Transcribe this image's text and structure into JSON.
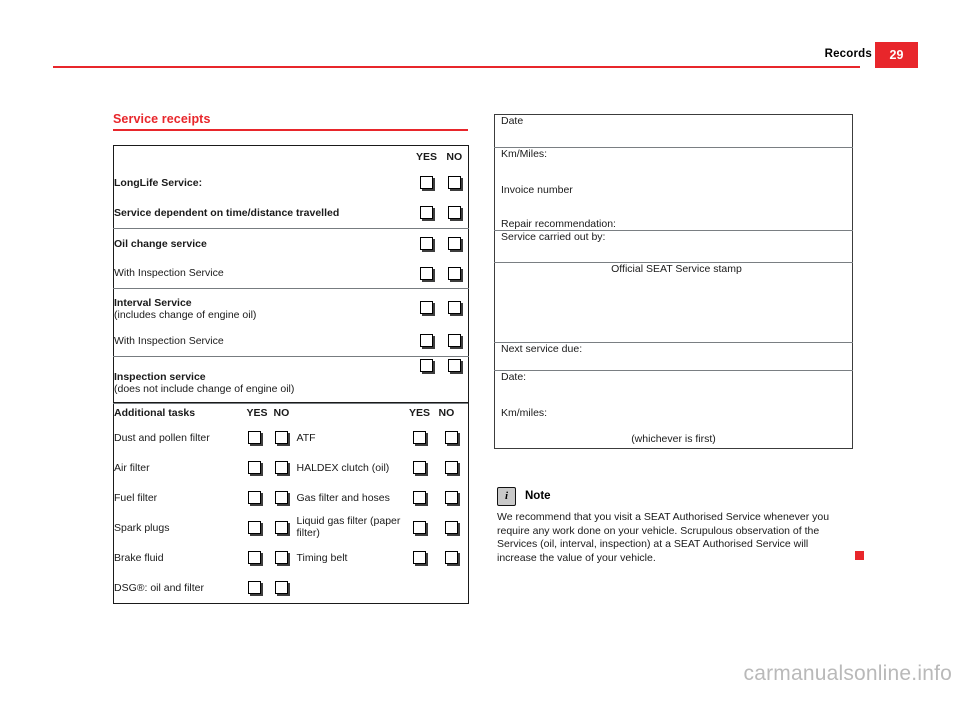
{
  "header": {
    "title": "Records",
    "page_number": "29"
  },
  "section": {
    "title": "Service receipts"
  },
  "service_table": {
    "yes_label": "YES",
    "no_label": "NO",
    "rows": [
      {
        "label": "LongLife Service:",
        "bold": true,
        "sub": ""
      },
      {
        "label": "Service dependent on time/distance travelled",
        "bold": true,
        "sub": ""
      },
      {
        "label": "Oil change service",
        "bold": true,
        "sub": ""
      },
      {
        "label": "With Inspection Service",
        "bold": false,
        "sub": ""
      },
      {
        "label": "Interval Service",
        "bold": true,
        "sub": "(includes change of engine oil)"
      },
      {
        "label": "With Inspection Service",
        "bold": false,
        "sub": ""
      },
      {
        "label": "Inspection service",
        "bold": true,
        "sub": "(does not include change of engine oil)"
      }
    ]
  },
  "additional_tasks": {
    "heading": "Additional tasks",
    "yes_label_left": "YES",
    "no_label_left": "NO",
    "yes_label_right": "YES",
    "no_label_right": "NO",
    "left_items": [
      "Dust and pollen filter",
      "Air filter",
      "Fuel filter",
      "Spark plugs",
      "Brake fluid",
      "DSG®: oil and filter"
    ],
    "right_items": [
      "ATF",
      "HALDEX clutch (oil)",
      "Gas filter and hoses",
      "Liquid gas filter (paper filter)",
      "Timing belt",
      ""
    ]
  },
  "receipt": {
    "date": "Date",
    "km_miles": "Km/Miles:",
    "invoice_number": "Invoice number",
    "repair_recommendation": "Repair recommendation:",
    "service_carried_out_by": "Service carried out by:",
    "official_stamp": "Official SEAT Service stamp",
    "next_service_due": "Next service due:",
    "next_date": "Date:",
    "next_km_miles": "Km/miles:",
    "whichever_first": "(whichever is first)"
  },
  "note": {
    "icon": "i",
    "label": "Note",
    "text": "We recommend that you visit a SEAT Authorised Service whenever you require any work done on your vehicle. Scrupulous observation of the Services (oil, interval, inspection) at a SEAT Authorised Service will increase the value of your vehicle."
  },
  "watermark": {
    "text": "carmanualsonline.info"
  },
  "colors": {
    "accent_red": "#e8262b",
    "text": "#1a1a1a",
    "rule_grey": "#7a7f83"
  }
}
